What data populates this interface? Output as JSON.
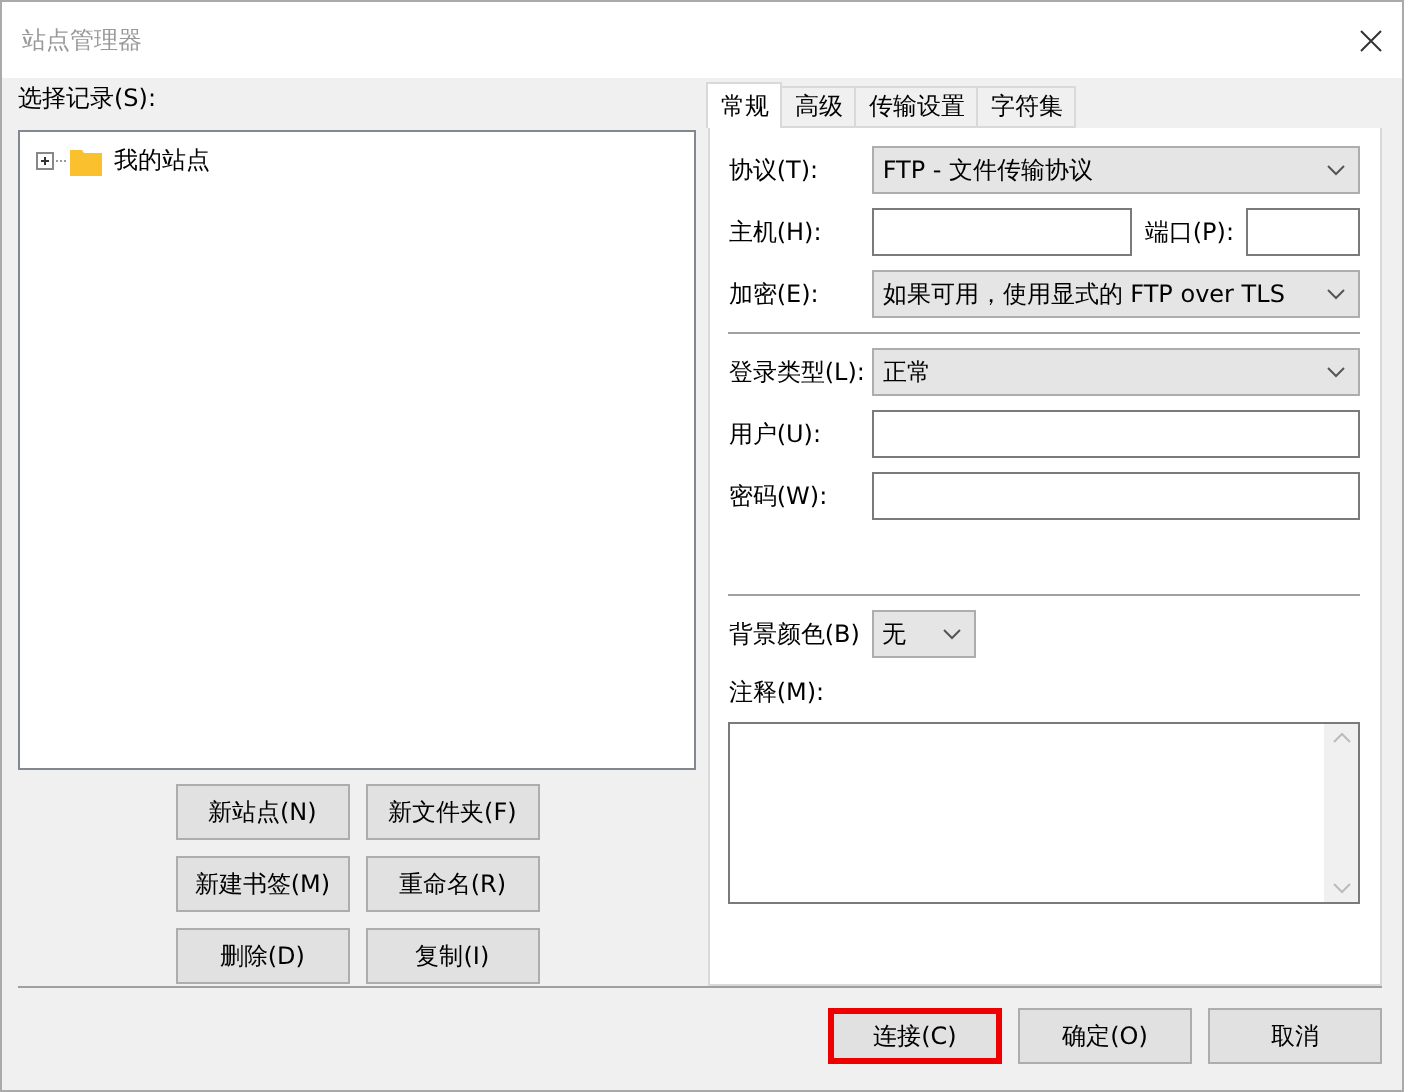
{
  "window": {
    "title": "站点管理器"
  },
  "tree": {
    "label": "选择记录(S):",
    "items": [
      {
        "label": "我的站点",
        "expanded": false
      }
    ]
  },
  "entry_buttons": [
    "新站点(N)",
    "新文件夹(F)",
    "新建书签(M)",
    "重命名(R)",
    "删除(D)",
    "复制(I)"
  ],
  "tabs": [
    {
      "label": "常规",
      "selected": true
    },
    {
      "label": "高级",
      "selected": false
    },
    {
      "label": "传输设置",
      "selected": false
    },
    {
      "label": "字符集",
      "selected": false
    }
  ],
  "general": {
    "protocol": {
      "label": "协议(T):",
      "value": "FTP - 文件传输协议"
    },
    "host": {
      "label": "主机(H):"
    },
    "port": {
      "label": "端口(P):"
    },
    "encryption": {
      "label": "加密(E):",
      "value": "如果可用，使用显式的 FTP over TLS"
    },
    "login_type": {
      "label": "登录类型(L):",
      "value": "正常"
    },
    "user": {
      "label": "用户(U):"
    },
    "password": {
      "label": "密码(W):"
    },
    "background_color": {
      "label": "背景颜色(B)",
      "value": "无"
    },
    "comments": {
      "label": "注释(M):"
    }
  },
  "dialog_buttons": [
    {
      "label": "连接(C)",
      "highlighted": true
    },
    {
      "label": "确定(O)",
      "highlighted": false
    },
    {
      "label": "取消",
      "highlighted": false
    }
  ]
}
